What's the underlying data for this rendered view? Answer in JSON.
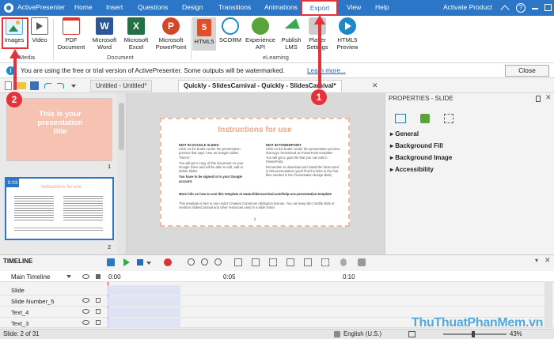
{
  "app": {
    "title": "ActivePresenter",
    "tabs": [
      "Home",
      "Insert",
      "Questions",
      "Design",
      "Transitions",
      "Animations",
      "Export",
      "View",
      "Help"
    ],
    "active_tab": "Export",
    "activate": "Activate Product"
  },
  "ribbon": {
    "media": {
      "label": "Media",
      "buttons": [
        "Images",
        "Video"
      ]
    },
    "document": {
      "label": "Document",
      "buttons": [
        "PDF\nDocument",
        "Microsoft\nWord",
        "Microsoft\nExcel",
        "Microsoft\nPowerPoint"
      ]
    },
    "elearning": {
      "label": "eLearning",
      "buttons": [
        "HTML5",
        "SCORM",
        "Experience\nAPI",
        "Publish\nLMS",
        "Player\nSettings",
        "HTML5\nPreview"
      ]
    }
  },
  "notice": {
    "text": "You are using the free or trial version of ActivePresenter. Some outputs will be watermarked.",
    "link": "Learn more...",
    "close": "Close"
  },
  "doc_tabs": [
    "Untitled - Untitled*",
    "Quickly - SlidesCarnival - Quickly - SlidesCarnival*"
  ],
  "slides": [
    {
      "number": "1",
      "title": "This is your presentation title"
    },
    {
      "number": "2",
      "time": "0:03",
      "title": "Instructions for use"
    }
  ],
  "slide": {
    "title": "Instructions for use",
    "left_heading": "EDIT IN GOOGLE SLIDES",
    "left_p1": "Click on the button under the presentation preview that says \"Use as Google Slides Theme\".",
    "left_p2": "You will get a copy of this document on your Google Drive and will be able to edit, add or delete slides.",
    "left_p3": "You have to be signed in to your Google account.",
    "right_heading": "EDIT IN POWERPOINT",
    "right_p1": "Click on the button under the presentation preview that says \"Download as PowerPoint template\". You will get a .pptx file that you can edit in PowerPoint.",
    "right_p2": "Remember to download and install the fonts used in this presentation (you'll find the links to the font files needed in the Presentation design slide)",
    "more": "More info on how to use this template at www.slidescarnival.com/help-use-presentation-template",
    "license": "This template is free to use under Creative Commons Attribution license. You can keep the Credits slide or mention SlidesCarnival and other resources used in a slide footer.",
    "page": "2"
  },
  "properties": {
    "title": "PROPERTIES - SLIDE",
    "sections": [
      "General",
      "Background Fill",
      "Background Image",
      "Accessibility"
    ]
  },
  "timeline": {
    "title": "TIMELINE",
    "main": "Main Timeline",
    "ticks": [
      "0:00",
      "0:05",
      "0:10"
    ],
    "tracks": [
      "Slide",
      "Slide Number_5",
      "Text_4",
      "Text_3"
    ]
  },
  "status": {
    "slide": "Slide: 2 of 31",
    "language": "English (U.S.)",
    "zoom": "43%"
  },
  "annotations": {
    "badge1": "1",
    "badge2": "2"
  },
  "watermark": {
    "text": "ThuThuatPhanMem.vn"
  },
  "colors": {
    "accent": "#2b76c6",
    "annotation": "#e5313b",
    "slide_title": "#f3a585"
  }
}
